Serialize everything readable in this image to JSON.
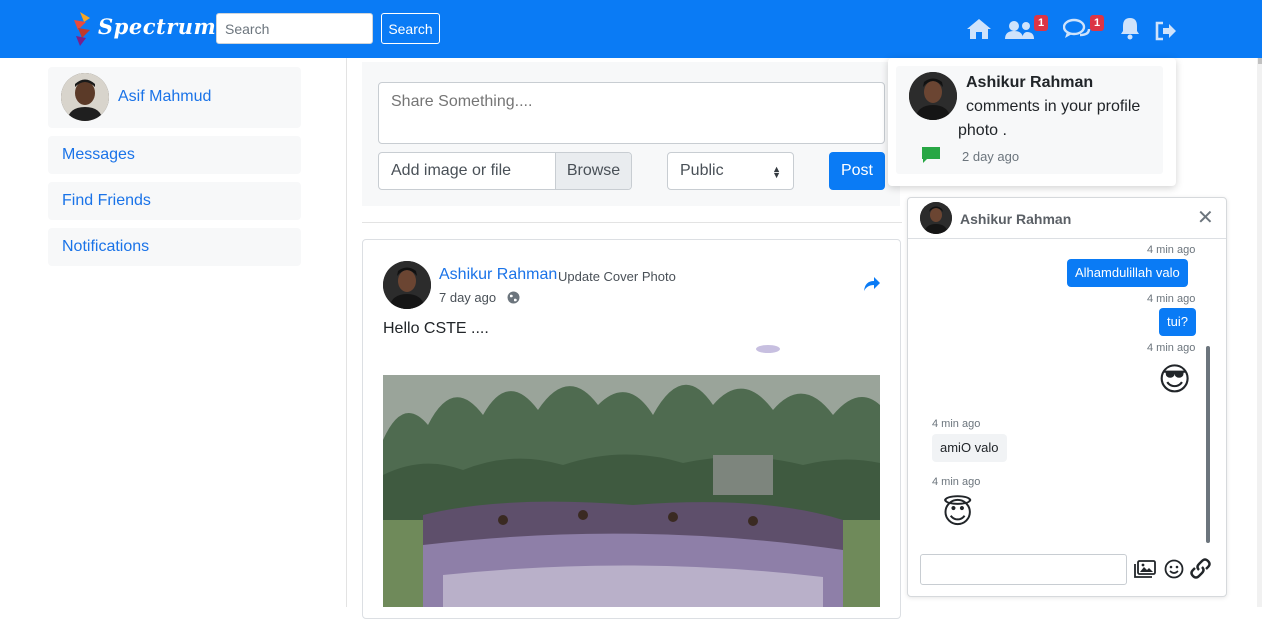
{
  "brand": {
    "name": "Spectrum"
  },
  "search": {
    "placeholder": "Search",
    "button_label": "Search"
  },
  "nav": {
    "icons": [
      "home-icon",
      "friends-icon",
      "messages-icon",
      "notifications-icon",
      "logout-icon"
    ],
    "friends_badge": "1",
    "messages_badge": "1"
  },
  "sidebar": {
    "profile_name": "Asif Mahmud",
    "items": [
      {
        "label": "Messages"
      },
      {
        "label": "Find Friends"
      },
      {
        "label": "Notifications"
      }
    ]
  },
  "composer": {
    "placeholder": "Share Something....",
    "file_label": "Add image or file",
    "browse_label": "Browse",
    "privacy_value": "Public",
    "post_label": "Post"
  },
  "post": {
    "author": "Ashikur Rahman",
    "action": "Update Cover Photo",
    "time": "7 day ago",
    "text": "Hello CSTE ...."
  },
  "notification": {
    "name": "Ashikur Rahman",
    "line1": "comments in your profile",
    "line2": "photo .",
    "time": "2 day ago"
  },
  "chat": {
    "name": "Ashikur Rahman",
    "messages": [
      {
        "time": "4 min ago",
        "text": "Alhamdulillah valo",
        "dir": "out"
      },
      {
        "time": "4 min ago",
        "text": "tui?",
        "dir": "out"
      },
      {
        "time": "4 min ago",
        "text": "😎",
        "dir": "out"
      },
      {
        "time": "4 min ago",
        "text": "amiO valo",
        "dir": "in"
      },
      {
        "time": "4 min ago",
        "text": "😇",
        "dir": "in"
      }
    ]
  },
  "colors": {
    "primary": "#0a7bf5",
    "badge": "#dc3545",
    "link": "#1a73e8"
  }
}
